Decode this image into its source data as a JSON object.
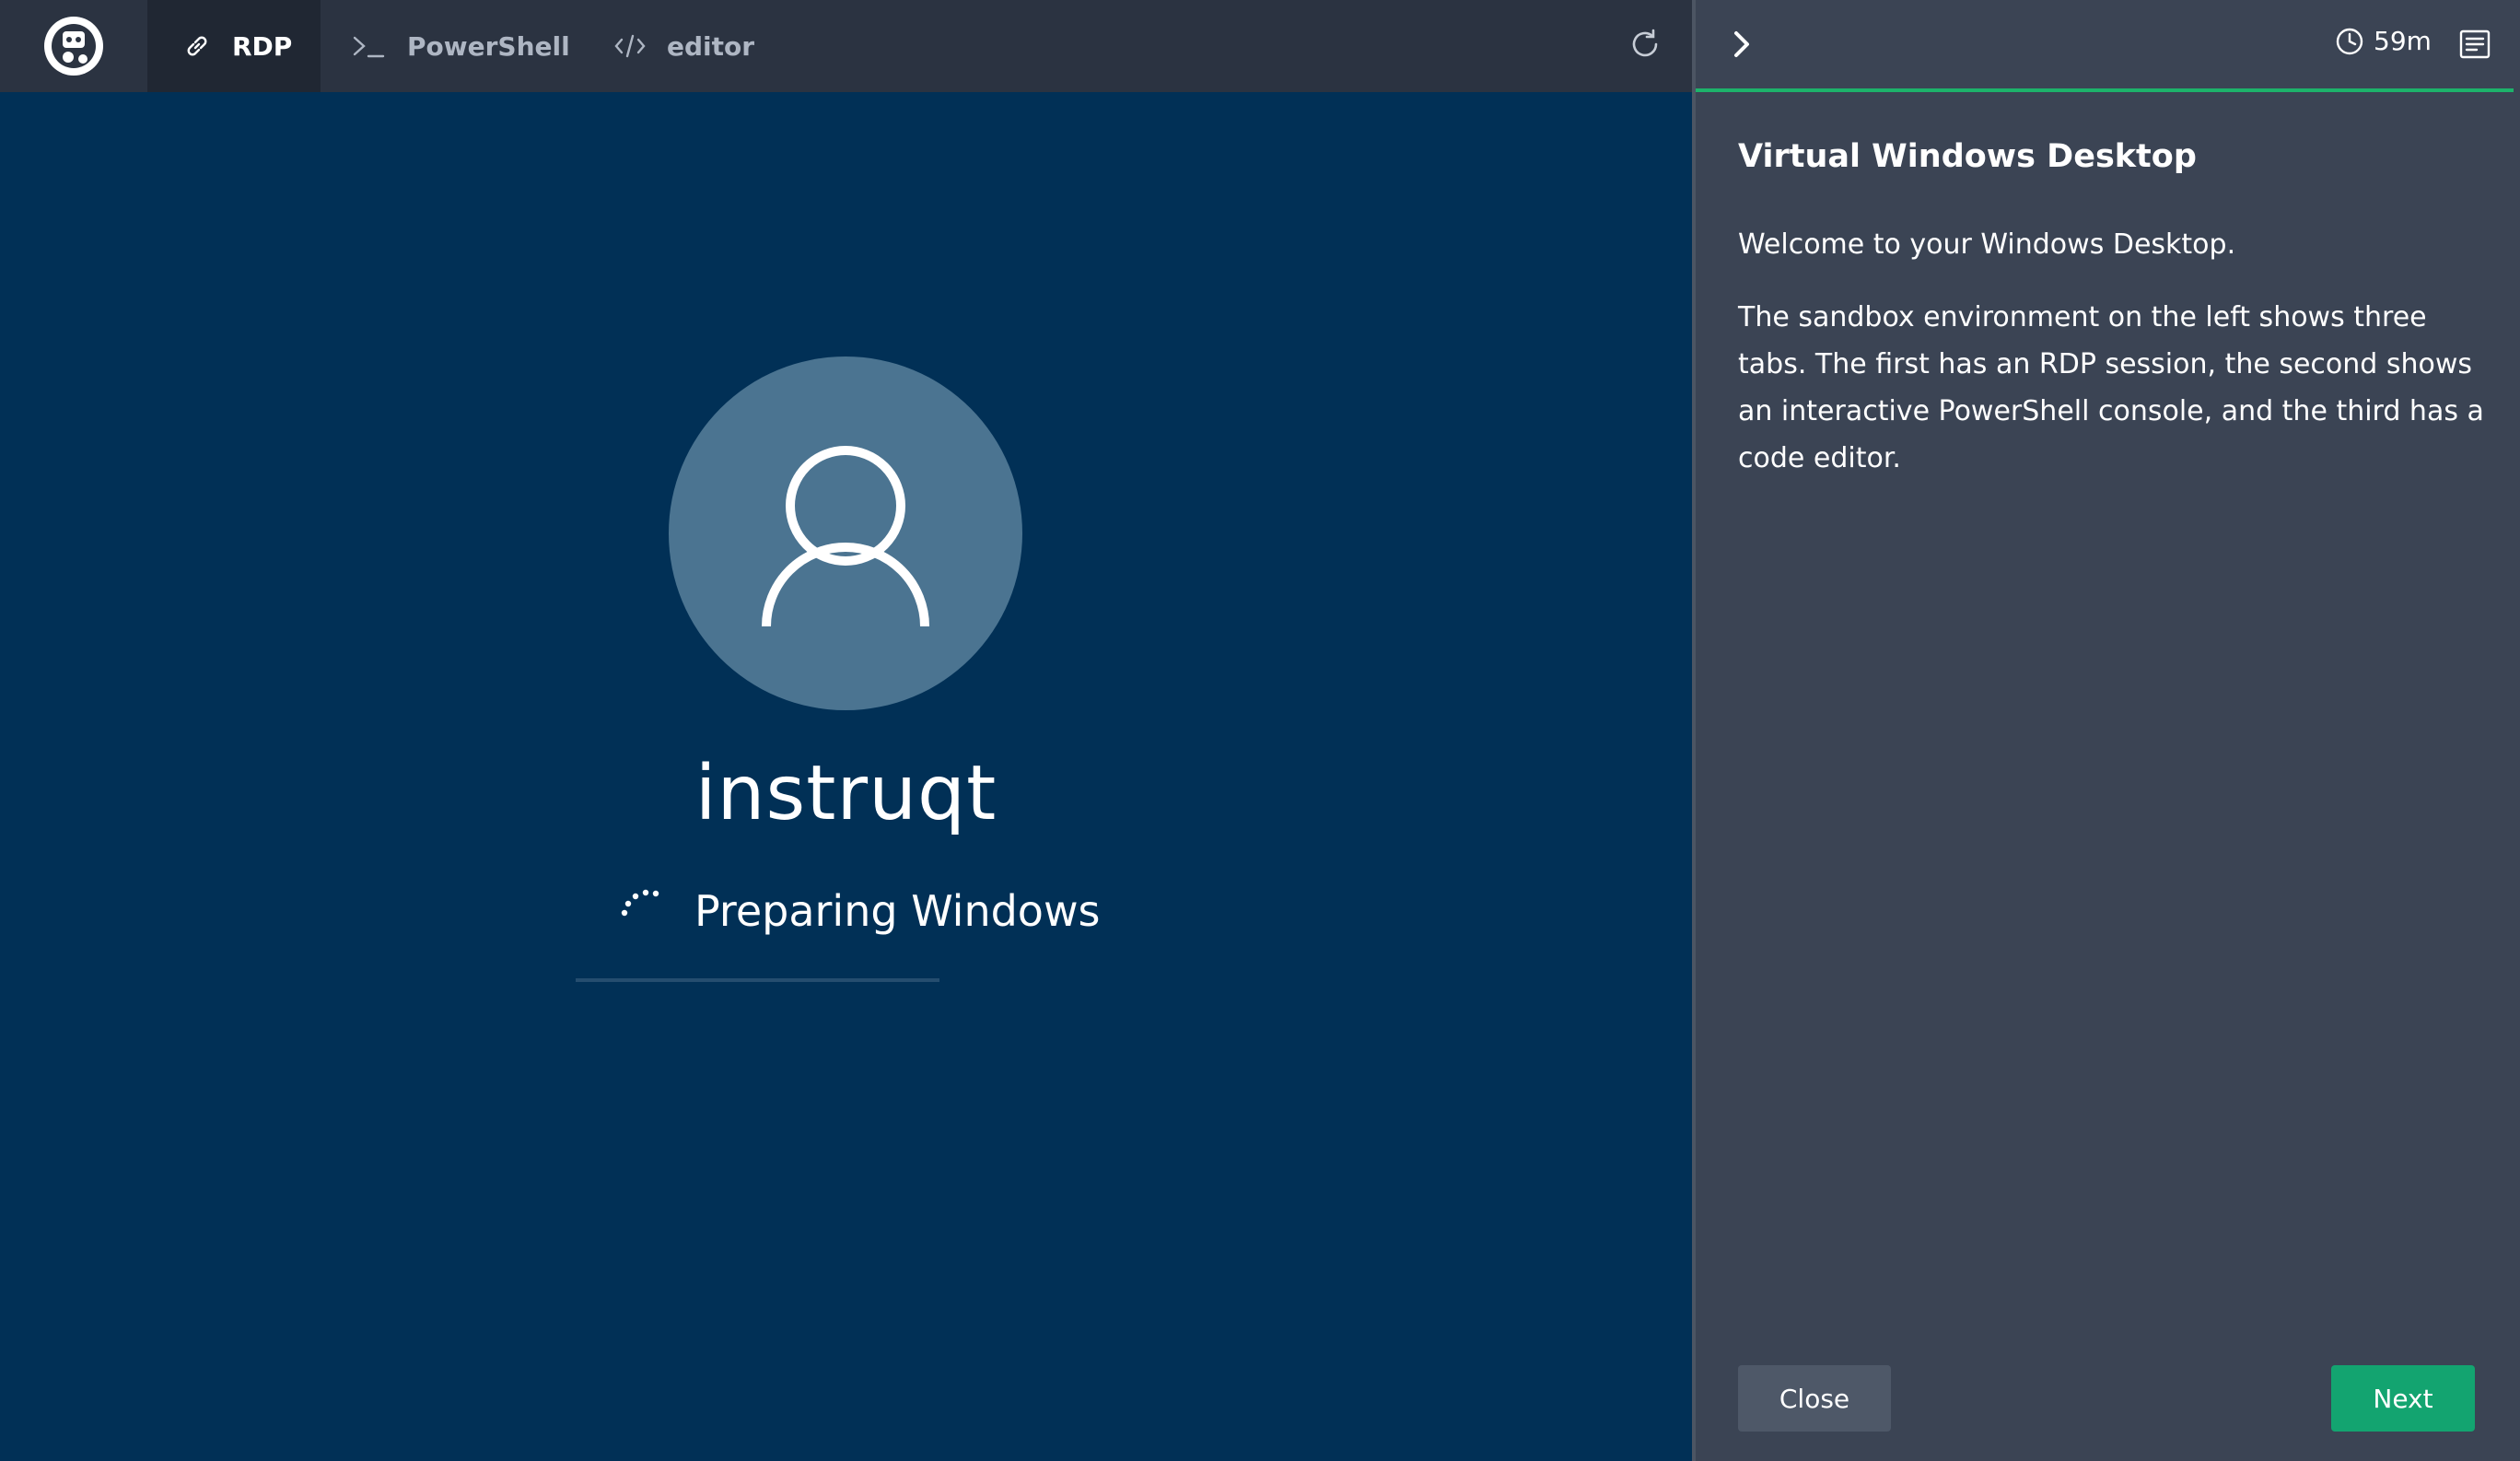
{
  "tabs": [
    {
      "label": "RDP",
      "icon": "link-icon",
      "active": true
    },
    {
      "label": "PowerShell",
      "icon": "terminal-icon",
      "active": false
    },
    {
      "label": "editor",
      "icon": "code-icon",
      "active": false
    }
  ],
  "rdp": {
    "username": "instruqt",
    "status": "Preparing Windows"
  },
  "panel": {
    "timer": "59m",
    "title": "Virtual Windows Desktop",
    "paragraphs": [
      "Welcome to your Windows Desktop.",
      "The sandbox environment on the left shows three tabs. The first has an RDP session, the second shows an interactive PowerShell console, and the third has a code editor."
    ],
    "close_label": "Close",
    "next_label": "Next"
  },
  "colors": {
    "desktop_bg": "#013056",
    "avatar_bg": "#4b7491",
    "topbar_bg": "#2b3341",
    "panel_bg": "#3b4454",
    "progress": "#1db36b",
    "next_button": "#13a470",
    "close_button": "#4e5868"
  }
}
